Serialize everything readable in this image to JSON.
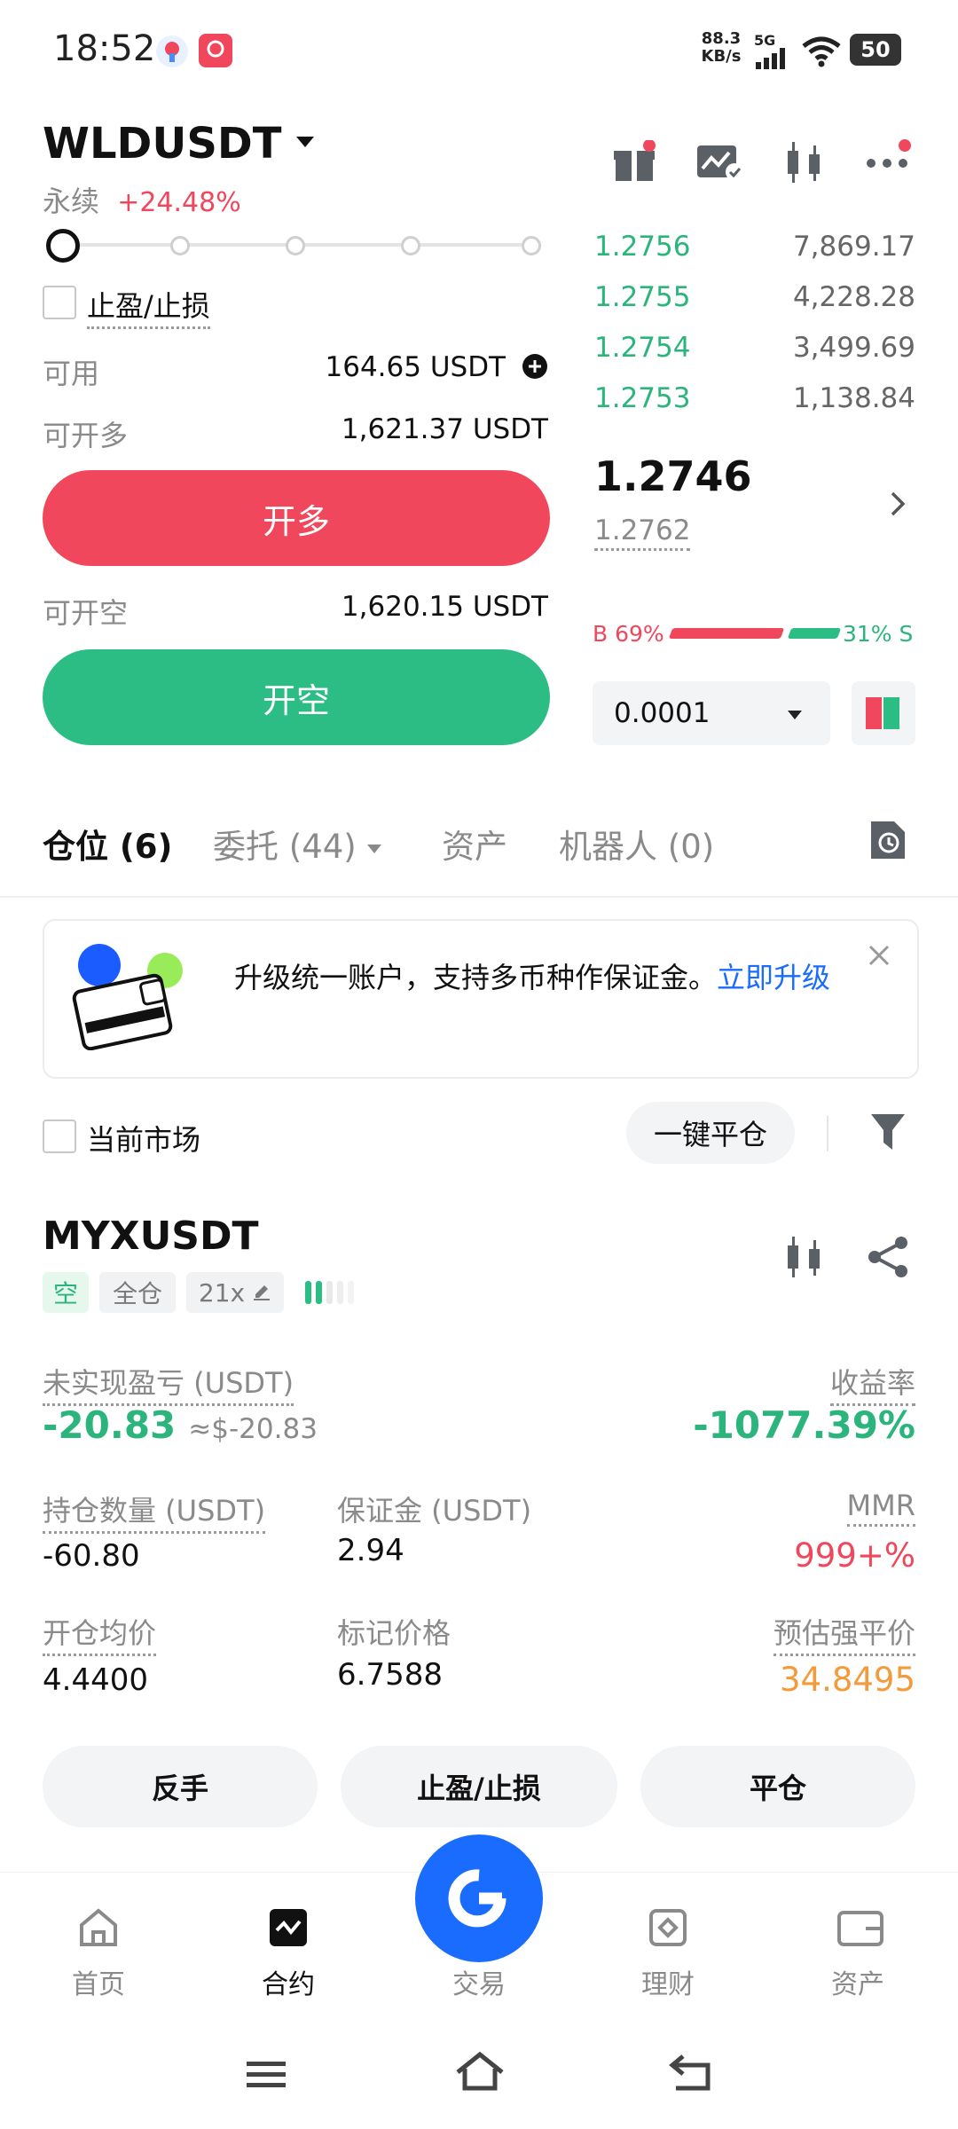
{
  "status_bar": {
    "time": "18:52",
    "net_speed": "88.3",
    "net_unit": "KB/s",
    "network": "5G",
    "battery": "50"
  },
  "header": {
    "pair": "WLDUSDT",
    "type": "永续",
    "change": "+24.48%"
  },
  "order_form": {
    "tp_sl_label": "止盈/止损",
    "available_label": "可用",
    "available_value": "164.65 USDT",
    "open_long_label": "可开多",
    "open_long_value": "1,621.37 USDT",
    "long_button": "开多",
    "open_short_label": "可开空",
    "open_short_value": "1,620.15 USDT",
    "short_button": "开空",
    "leverage_slider_level": 0
  },
  "orderbook": {
    "asks": [
      {
        "price": "1.2756",
        "qty": "7,869.17"
      },
      {
        "price": "1.2755",
        "qty": "4,228.28"
      },
      {
        "price": "1.2754",
        "qty": "3,499.69"
      },
      {
        "price": "1.2753",
        "qty": "1,138.84"
      }
    ],
    "last_price": "1.2746",
    "mark_price": "1.2762",
    "buy_ratio": "B 69%",
    "sell_ratio": "31% S",
    "buy_fraction": 0.69,
    "precision": "0.0001"
  },
  "tabs": {
    "positions": "仓位 (6)",
    "orders": "委托 (44)",
    "assets": "资产",
    "bots": "机器人 (0)"
  },
  "banner": {
    "text": "升级统一账户，支持多币种作保证金。",
    "link": "立即升级"
  },
  "filter": {
    "current_market": "当前市场",
    "close_all": "一键平仓"
  },
  "position": {
    "symbol": "MYXUSDT",
    "side": "空",
    "margin_mode": "全仓",
    "leverage": "21x",
    "pnl_label": "未实现盈亏 (USDT)",
    "pnl_value": "-20.83",
    "pnl_usd": "≈$-20.83",
    "roe_label": "收益率",
    "roe_value": "-1077.39%",
    "size_label": "持仓数量 (USDT)",
    "size_value": "-60.80",
    "margin_label": "保证金 (USDT)",
    "margin_value": "2.94",
    "mmr_label": "MMR",
    "mmr_value": "999+%",
    "entry_label": "开仓均价",
    "entry_value": "4.4400",
    "mark_label": "标记价格",
    "mark_value": "6.7588",
    "liq_label": "预估强平价",
    "liq_value": "34.8495",
    "btn_reverse": "反手",
    "btn_tpsl": "止盈/止损",
    "btn_close": "平仓"
  },
  "bottom_nav": {
    "home": "首页",
    "futures": "合约",
    "trade": "交易",
    "earn": "理财",
    "assets": "资产"
  },
  "colors": {
    "red": "#f0475c",
    "green": "#2bb47c",
    "blue": "#1a6cff",
    "orange": "#f39a3a"
  }
}
